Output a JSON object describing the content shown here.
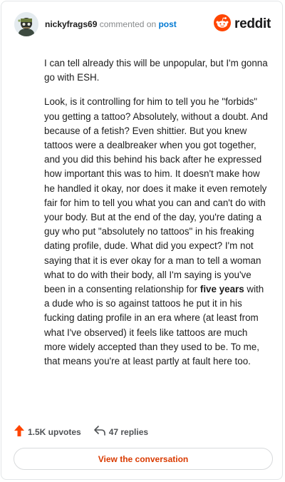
{
  "header": {
    "username": "nickyfrags69",
    "action": "commented on",
    "post_link": "post",
    "brand": "reddit"
  },
  "comment": {
    "p1": "I can tell already this will be unpopular, but I'm gonna go with ESH.",
    "p2_before": "Look, is it controlling for him to tell you he \"forbids\" you getting a tattoo? Absolutely, without a doubt. And because of a fetish? Even shittier. But you knew tattoos were a dealbreaker when you got together, and you did this behind his back after he expressed how important this was to him. It doesn't make how he handled it okay, nor does it make it even remotely fair for him to tell you what you can and can't do with your body. But at the end of the day, you're dating a guy who put \"absolutely no tattoos\" in his freaking dating profile, dude. What did you expect? I'm not saying that it is ever okay for a man to tell a woman what to do with their body, all I'm saying is you've been in a consenting relationship for ",
    "p2_bold": "five years",
    "p2_after": " with a dude who is so against tattoos he put it in his fucking dating profile in an era where (at least from what I've observed) it feels like tattoos are much more widely accepted than they used to be. To me, that means you're at least partly at fault here too."
  },
  "footer": {
    "upvotes": "1.5K upvotes",
    "replies": "47 replies",
    "view_button": "View the conversation"
  },
  "colors": {
    "accent": "#ff4500",
    "link": "#0079d3",
    "button_text": "#d93a00"
  },
  "icons": [
    "avatar",
    "reddit-logo-icon",
    "upvote-arrow-icon",
    "reply-arrow-icon"
  ]
}
